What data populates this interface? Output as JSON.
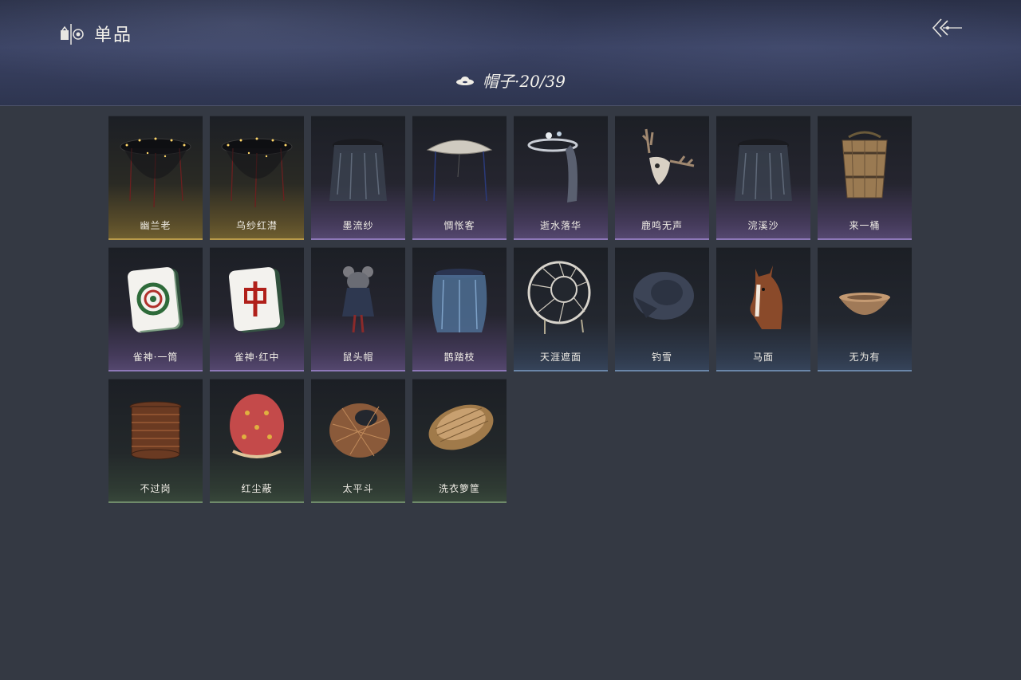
{
  "header": {
    "title": "单品",
    "category_label": "帽子·20/39"
  },
  "items": [
    {
      "name": "幽兰老",
      "rarity": "gold",
      "icon": "black-veiled-hat-with-lights-icon"
    },
    {
      "name": "乌纱红潸",
      "rarity": "gold",
      "icon": "black-veiled-hat-with-lights-icon"
    },
    {
      "name": "墨流纱",
      "rarity": "purple",
      "icon": "dark-veil-hat-icon"
    },
    {
      "name": "惆怅客",
      "rarity": "purple",
      "icon": "white-bamboo-hat-icon"
    },
    {
      "name": "逝水落华",
      "rarity": "purple",
      "icon": "flower-crown-veil-icon"
    },
    {
      "name": "鹿鸣无声",
      "rarity": "purple",
      "icon": "deer-skull-icon"
    },
    {
      "name": "浣溪沙",
      "rarity": "purple",
      "icon": "dark-veil-hat-icon"
    },
    {
      "name": "来一桶",
      "rarity": "purple",
      "icon": "wooden-bucket-icon"
    },
    {
      "name": "雀神·一筒",
      "rarity": "purple",
      "icon": "mahjong-tile-one-circle-icon"
    },
    {
      "name": "雀神·红中",
      "rarity": "purple",
      "icon": "mahjong-tile-red-zhong-icon"
    },
    {
      "name": "鼠头帽",
      "rarity": "purple",
      "icon": "rat-head-hat-icon"
    },
    {
      "name": "鹊踏枝",
      "rarity": "purple",
      "icon": "blue-veil-hat-icon"
    },
    {
      "name": "天涯遮面",
      "rarity": "blue",
      "icon": "woven-frame-hat-icon"
    },
    {
      "name": "钓雪",
      "rarity": "blue",
      "icon": "dark-straw-hat-icon"
    },
    {
      "name": "马面",
      "rarity": "blue",
      "icon": "horse-head-icon"
    },
    {
      "name": "无为有",
      "rarity": "blue",
      "icon": "clay-bowl-icon"
    },
    {
      "name": "不过岗",
      "rarity": "green",
      "icon": "stacked-bowls-icon"
    },
    {
      "name": "红尘蔽",
      "rarity": "green",
      "icon": "red-cloth-hood-icon"
    },
    {
      "name": "太平斗",
      "rarity": "green",
      "icon": "wicker-basket-hat-icon"
    },
    {
      "name": "洗衣箩筐",
      "rarity": "green",
      "icon": "laundry-basket-icon"
    }
  ],
  "colors": {
    "background": "#343943",
    "gold": "#b99a4a",
    "purple": "#8d78b8",
    "blue": "#6a86a8",
    "green": "#6f8a6a"
  }
}
